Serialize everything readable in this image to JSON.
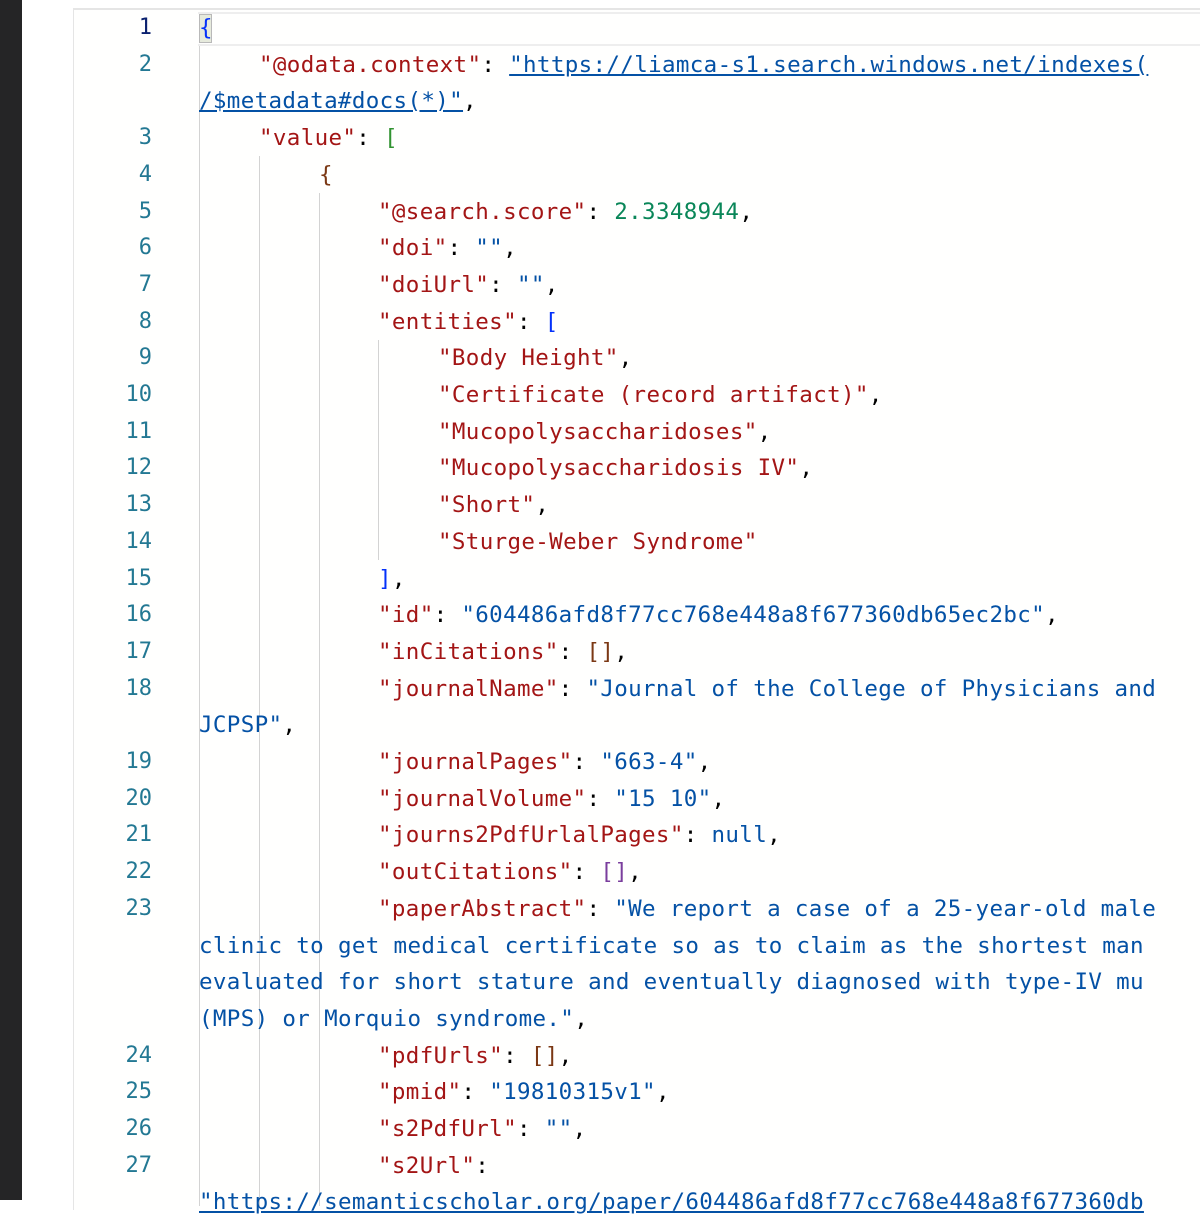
{
  "editor": {
    "active_line": 1,
    "lines": [
      {
        "no": "1",
        "text": "{"
      },
      {
        "no": "2",
        "key": "\"@odata.context\"",
        "value": "\"https://liamca-s1.search.windows.net/indexes(",
        "wrap": "/$metadata#docs(*)\"",
        "wrap_tail": ","
      },
      {
        "no": "3",
        "key": "\"value\"",
        "tail": ": ["
      },
      {
        "no": "4",
        "text": "{"
      },
      {
        "no": "5",
        "key": "\"@search.score\"",
        "value": "2.3348944"
      },
      {
        "no": "6",
        "key": "\"doi\"",
        "value": "\"\""
      },
      {
        "no": "7",
        "key": "\"doiUrl\"",
        "value": "\"\""
      },
      {
        "no": "8",
        "key": "\"entities\"",
        "tail": ": ["
      },
      {
        "no": "9",
        "item": "\"Body Height\""
      },
      {
        "no": "10",
        "item": "\"Certificate (record artifact)\""
      },
      {
        "no": "11",
        "item": "\"Mucopolysaccharidoses\""
      },
      {
        "no": "12",
        "item": "\"Mucopolysaccharidosis IV\""
      },
      {
        "no": "13",
        "item": "\"Short\""
      },
      {
        "no": "14",
        "item": "\"Sturge-Weber Syndrome\""
      },
      {
        "no": "15",
        "text": "],"
      },
      {
        "no": "16",
        "key": "\"id\"",
        "value": "\"604486afd8f77cc768e448a8f677360db65ec2bc\""
      },
      {
        "no": "17",
        "key": "\"inCitations\"",
        "value": "[]"
      },
      {
        "no": "18",
        "key": "\"journalName\"",
        "value": "\"Journal of the College of Physicians and",
        "wrap": "JCPSP\"",
        "wrap_tail": ","
      },
      {
        "no": "19",
        "key": "\"journalPages\"",
        "value": "\"663-4\""
      },
      {
        "no": "20",
        "key": "\"journalVolume\"",
        "value": "\"15 10\""
      },
      {
        "no": "21",
        "key": "\"journs2PdfUrlalPages\"",
        "value": "null"
      },
      {
        "no": "22",
        "key": "\"outCitations\"",
        "value": "[]"
      },
      {
        "no": "23",
        "key": "\"paperAbstract\"",
        "value": "\"We report a case of a 25-year-old male",
        "wrap_lines": [
          "clinic to get medical certificate so as to claim as the shortest man",
          "evaluated for short stature and eventually diagnosed with type-IV mu",
          "(MPS) or Morquio syndrome.\""
        ],
        "wrap_tail": ","
      },
      {
        "no": "24",
        "key": "\"pdfUrls\"",
        "value": "[]"
      },
      {
        "no": "25",
        "key": "\"pmid\"",
        "value": "\"19810315v1\""
      },
      {
        "no": "26",
        "key": "\"s2PdfUrl\"",
        "value": "\"\""
      },
      {
        "no": "27",
        "key": "\"s2Url\"",
        "tail": ":",
        "wrap": "\"https://semanticscholar.org/paper/604486afd8f77cc768e448a8f677360db"
      }
    ]
  }
}
